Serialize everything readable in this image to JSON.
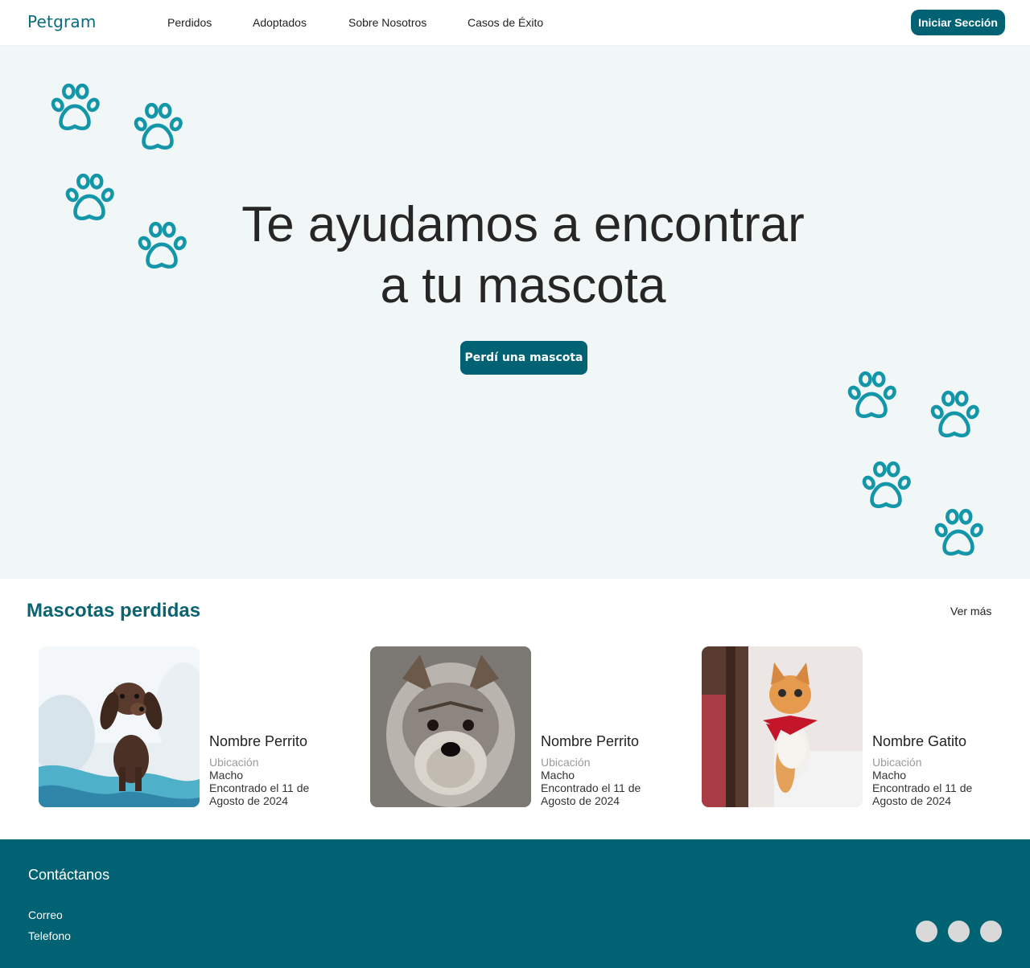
{
  "header": {
    "logo": "Petgram",
    "nav": [
      "Perdidos",
      "Adoptados",
      "Sobre Nosotros",
      "Casos de Éxito"
    ],
    "login_label": "Iniciar Sección"
  },
  "hero": {
    "title_line1": "Te ayudamos a encontrar",
    "title_line2": "a tu mascota",
    "cta_label": "Perdí una mascota",
    "paw_color": "#1296a8",
    "bg_color": "#f1f6f7"
  },
  "lost_pets": {
    "title": "Mascotas perdidas",
    "see_more": "Ver más",
    "cards": [
      {
        "name": "Nombre Perrito",
        "location": "Ubicación",
        "sex": "Macho",
        "date": "Encontrado el 11 de Agosto de 2024",
        "photo": "dachshund-puppy"
      },
      {
        "name": "Nombre Perrito",
        "location": "Ubicación",
        "sex": "Macho",
        "date": "Encontrado el 11 de Agosto de 2024",
        "photo": "yorkshire-terrier"
      },
      {
        "name": "Nombre Gatito",
        "location": "Ubicación",
        "sex": "Macho",
        "date": "Encontrado el 11 de Agosto de 2024",
        "photo": "orange-cat-red-bandana"
      }
    ]
  },
  "footer": {
    "title": "Contáctanos",
    "email_label": "Correo",
    "phone_label": "Telefono",
    "social_icons": [
      "social-icon",
      "social-icon",
      "social-icon"
    ]
  },
  "colors": {
    "brand": "#006272",
    "brand_text": "#0b6b78",
    "footer_bg": "#006272"
  }
}
